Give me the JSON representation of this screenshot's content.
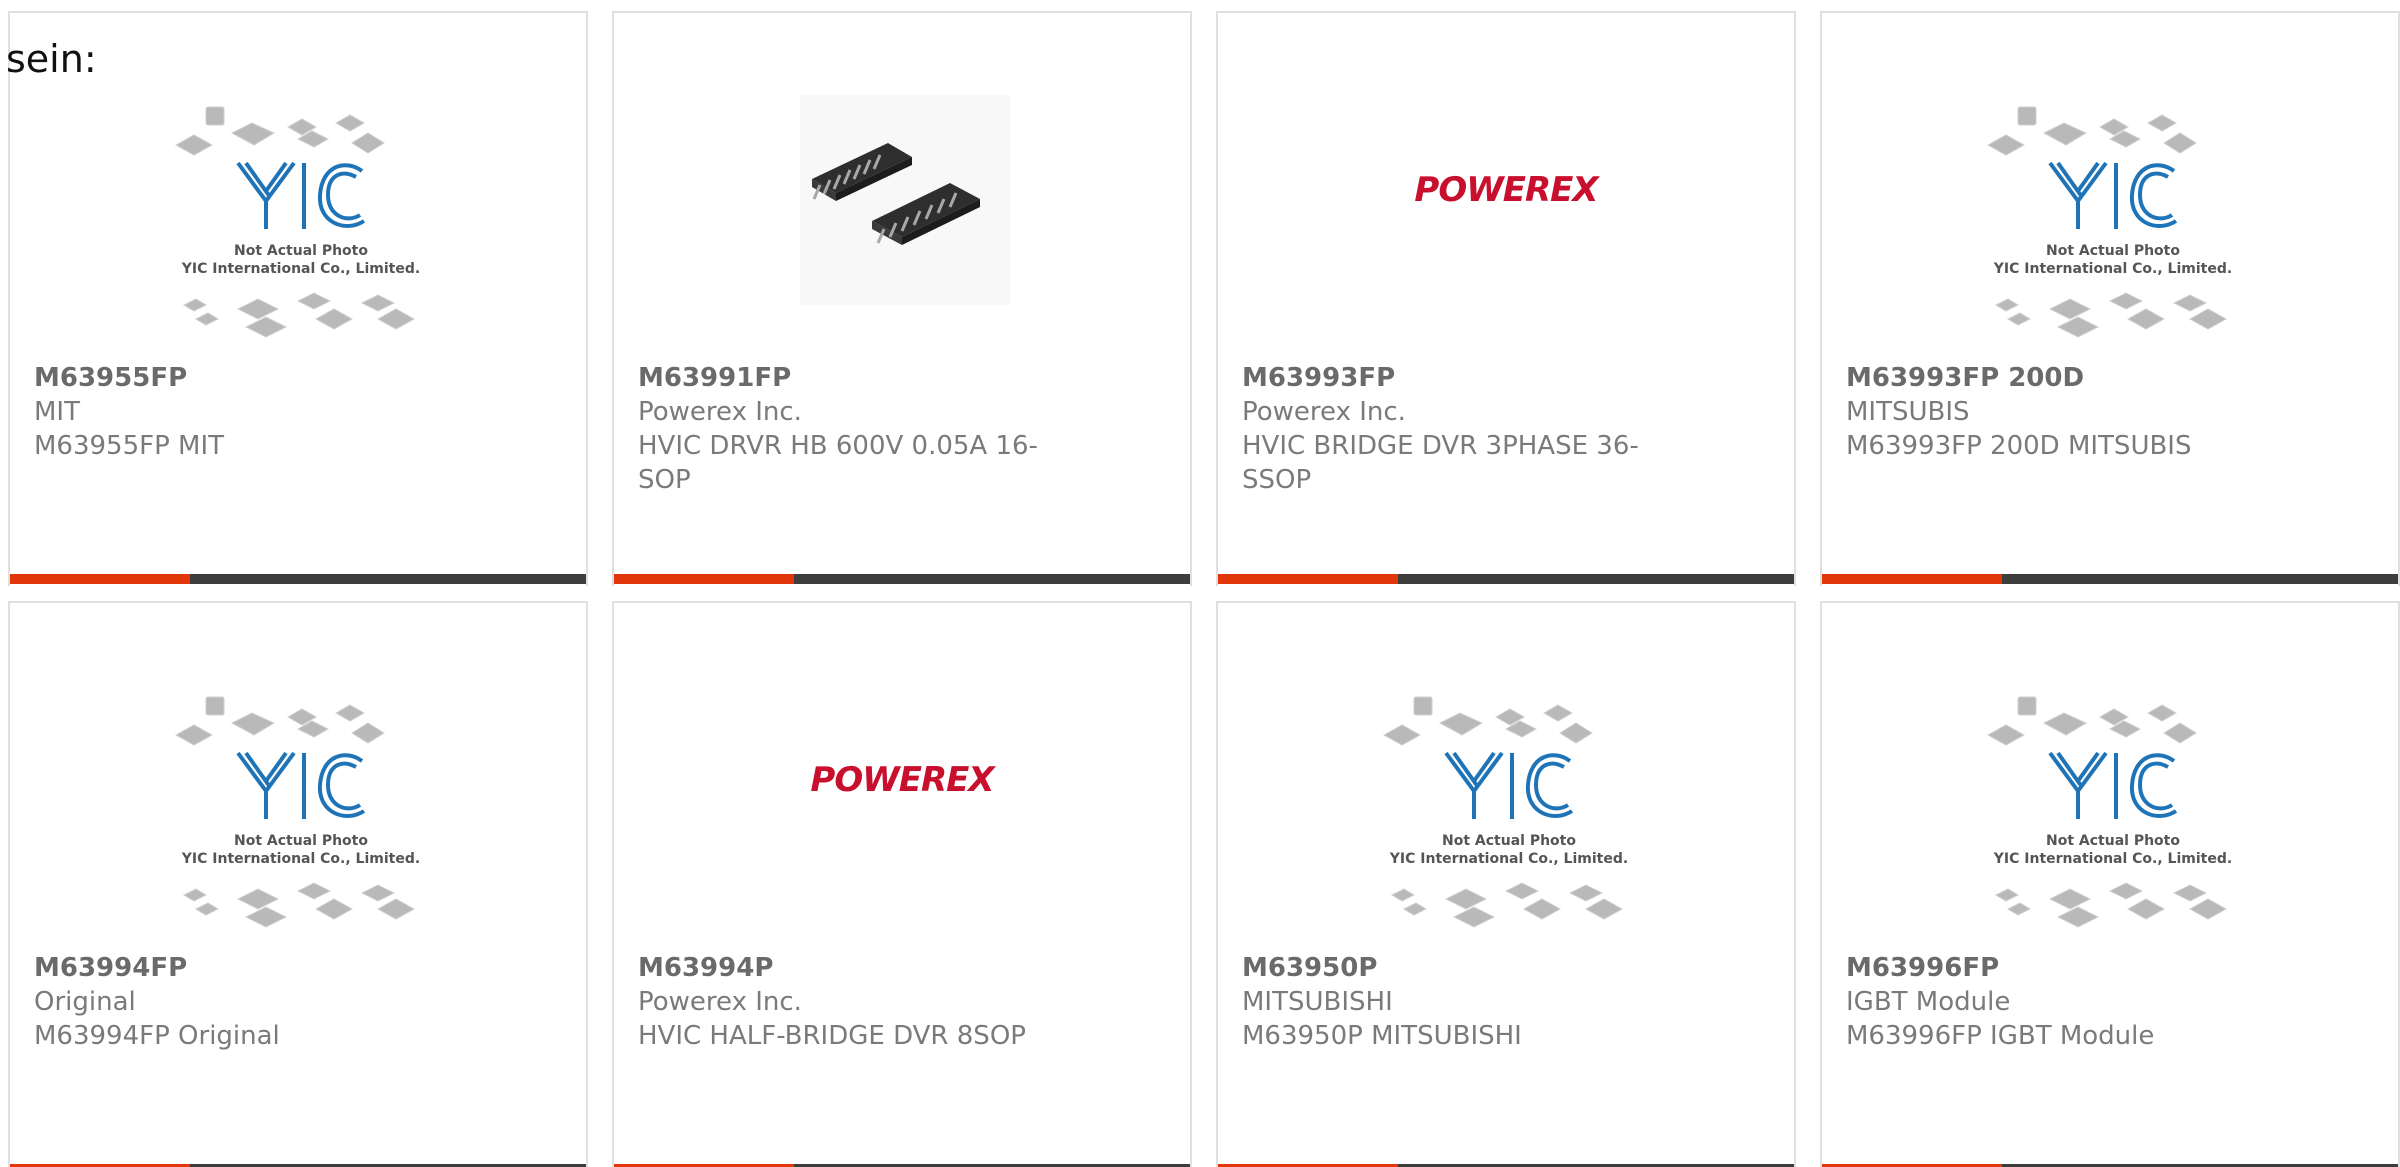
{
  "intro_text": "sein:",
  "colors": {
    "accent": "#e2360b",
    "bar_dark": "#3d3d3d",
    "border": "#e0e0e0",
    "text": "#7a7a7a",
    "yic_blue": "#1f74b8",
    "powerex_red": "#c8102e"
  },
  "placeholder": {
    "logo": "YIC",
    "line1": "Not Actual Photo",
    "line2": "YIC International Co., Limited."
  },
  "powerex_logo": "POWEREX",
  "products": [
    {
      "part": "M63955FP",
      "manufacturer": "MIT",
      "description": "M63955FP MIT",
      "image": "yic-placeholder"
    },
    {
      "part": "M63991FP",
      "manufacturer": "Powerex Inc.",
      "description": "HVIC DRVR HB 600V 0.05A 16-SOP",
      "image": "ic-package-photo"
    },
    {
      "part": "M63993FP",
      "manufacturer": "Powerex Inc.",
      "description": "HVIC BRIDGE DVR 3PHASE 36-SSOP",
      "image": "powerex-logo"
    },
    {
      "part": "M63993FP 200D",
      "manufacturer": "MITSUBIS",
      "description": "M63993FP 200D MITSUBIS",
      "image": "yic-placeholder"
    },
    {
      "part": "M63994FP",
      "manufacturer": "Original",
      "description": "M63994FP Original",
      "image": "yic-placeholder"
    },
    {
      "part": "M63994P",
      "manufacturer": "Powerex Inc.",
      "description": "HVIC HALF-BRIDGE DVR 8SOP",
      "image": "powerex-logo"
    },
    {
      "part": "M63950P",
      "manufacturer": "MITSUBISHI",
      "description": "M63950P MITSUBISHI",
      "image": "yic-placeholder"
    },
    {
      "part": "M63996FP",
      "manufacturer": "IGBT Module",
      "description": "M63996FP IGBT Module",
      "image": "yic-placeholder"
    }
  ]
}
